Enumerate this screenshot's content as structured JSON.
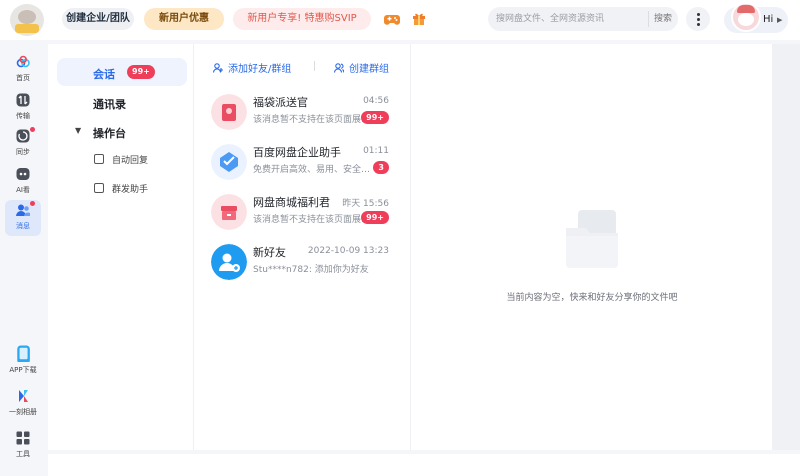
{
  "header": {
    "team_button": "创建企业/团队",
    "newuser_button": "新用户优惠",
    "svip_promo": "新用户专享! 特惠购SVIP",
    "search_placeholder": "搜网盘文件、全网资源资讯",
    "search_button": "搜索",
    "user_greeting": "Hi"
  },
  "leftnav": {
    "items": [
      {
        "label": "首页",
        "icon": "cloud-home-icon"
      },
      {
        "label": "传输",
        "icon": "transfer-icon"
      },
      {
        "label": "同步",
        "icon": "sync-icon"
      },
      {
        "label": "AI看",
        "icon": "ai-watch-icon"
      },
      {
        "label": "消息",
        "icon": "message-icon"
      }
    ],
    "bottom": [
      {
        "label": "APP下载",
        "icon": "phone-icon"
      },
      {
        "label": "一刻相册",
        "icon": "album-icon"
      },
      {
        "label": "工具",
        "icon": "tools-icon"
      }
    ]
  },
  "subnav": {
    "chat_label": "会话",
    "chat_badge": "99+",
    "contacts_label": "通讯录",
    "console_label": "操作台",
    "auto_reply_label": "自动回复",
    "group_send_label": "群发助手"
  },
  "list_actions": {
    "add_friend": "添加好友/群组",
    "create_group": "创建群组"
  },
  "conversations": [
    {
      "name": "福袋派送官",
      "time": "04:56",
      "preview": "该消息暂不支持在该页面展示...",
      "badge": "99+"
    },
    {
      "name": "百度网盘企业助手",
      "time": "01:11",
      "preview": "免费开启高效、易用、安全的...",
      "badge": "3"
    },
    {
      "name": "网盘商城福利君",
      "time": "昨天 15:56",
      "preview": "该消息暂不支持在该页面展示...",
      "badge": "99+"
    },
    {
      "name": "新好友",
      "time": "2022-10-09 13:23",
      "preview": "Stu****n782: 添加你为好友",
      "badge": ""
    }
  ],
  "empty_state": {
    "text": "当前内容为空，快来和好友分享你的文件吧"
  },
  "colors": {
    "accent": "#2a6ae9",
    "badge": "#ef3e5a"
  }
}
